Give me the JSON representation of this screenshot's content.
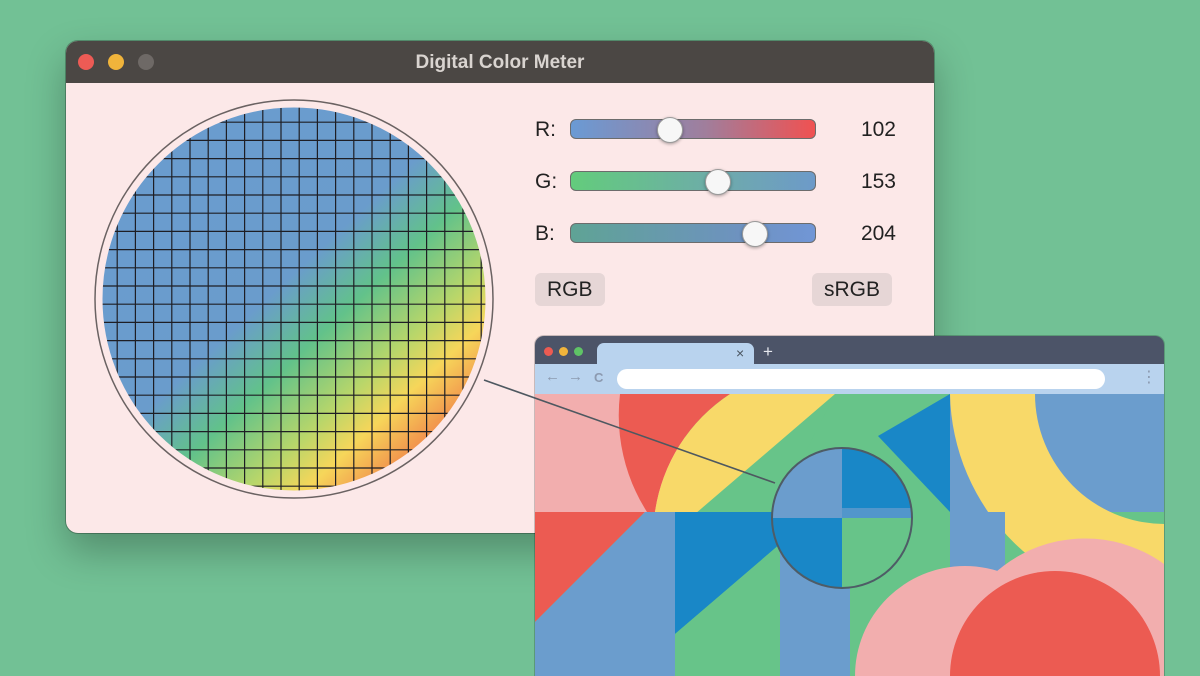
{
  "meter": {
    "title": "Digital Color Meter",
    "channels": [
      {
        "label": "R:",
        "value": "102",
        "fraction": 0.4
      },
      {
        "label": "G:",
        "value": "153",
        "fraction": 0.6
      },
      {
        "label": "B:",
        "value": "204",
        "fraction": 0.75
      }
    ],
    "mode_label": "RGB",
    "profile_label": "sRGB"
  },
  "browser": {
    "new_tab_label": "+",
    "close_tab_label": "×",
    "back_label": "←",
    "forward_label": "→",
    "reload_label": "C",
    "menu_label": "⋮"
  },
  "colors": {
    "background": "#72c195",
    "meter_body": "#fce8e8",
    "titlebar": "#4b4744",
    "accent_blue": "#6b9dcd",
    "accent_green": "#67c489",
    "accent_yellow": "#f8d969",
    "accent_red": "#ec5b52",
    "accent_pink": "#f2aeae",
    "accent_deep_blue": "#1987c7"
  }
}
